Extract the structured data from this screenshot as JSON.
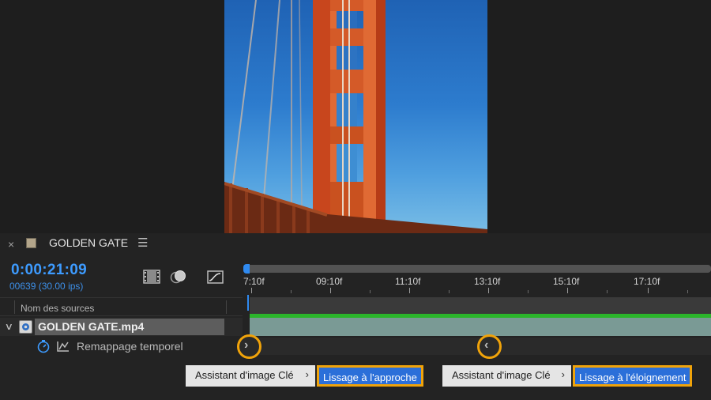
{
  "panel": {
    "close_glyph": "×",
    "title": "GOLDEN GATE",
    "menu_glyph": "☰"
  },
  "time": {
    "timecode": "0:00:21:09",
    "frame_info": "00639 (30.00 ips)"
  },
  "ruler": {
    "labels": [
      "7:10f",
      "09:10f",
      "11:10f",
      "13:10f",
      "15:10f",
      "17:10f"
    ]
  },
  "columns": {
    "source_name": "Nom des sources"
  },
  "layer": {
    "expand_glyph": "∨",
    "name": "GOLDEN GATE.mp4"
  },
  "property": {
    "name": "Remappage temporel"
  },
  "keyframes": {
    "left_glyph": "›",
    "right_glyph": "‹"
  },
  "menus": [
    {
      "item": "Assistant d'image Clé",
      "arrow": "›",
      "submenu": "Lissage à l'approche"
    },
    {
      "item": "Assistant d'image Clé",
      "arrow": "›",
      "submenu": "Lissage à l'éloignement"
    }
  ],
  "colors": {
    "accent_blue": "#3d9bff",
    "highlight_orange": "#f0a30a",
    "layer_bar_green": "#2bb52b",
    "layer_track": "#7a9a95"
  },
  "icons": [
    "film-icon",
    "motion-blur-icon",
    "graph-editor-icon",
    "stopwatch-icon",
    "graph-icon",
    "footage-icon"
  ]
}
